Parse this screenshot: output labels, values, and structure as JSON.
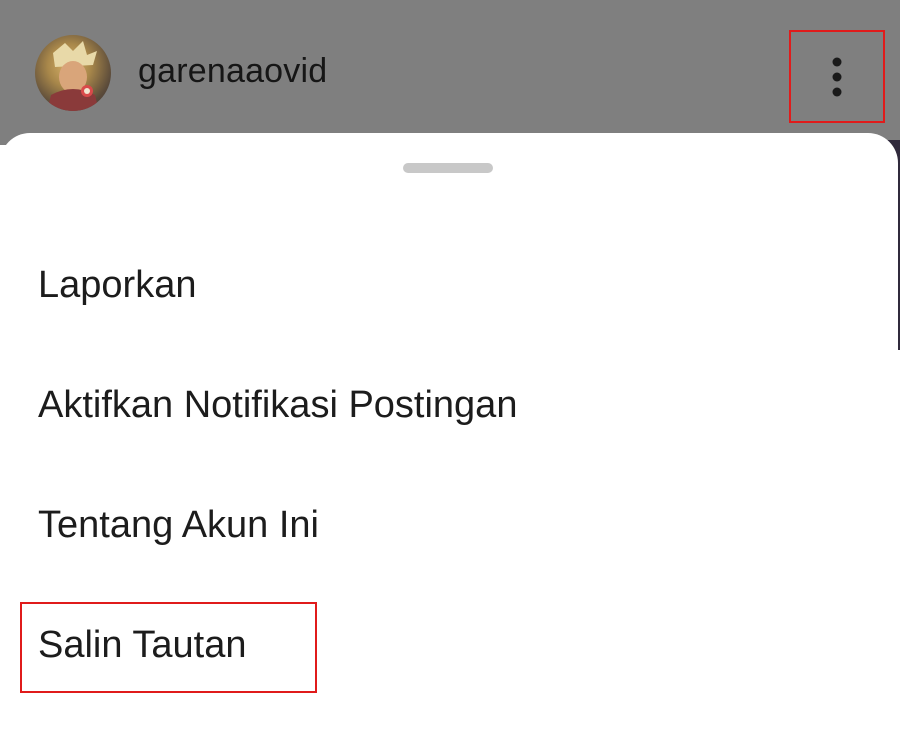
{
  "header": {
    "username": "garenaaovid",
    "avatar_icon": "profile-avatar",
    "more_icon": "vertical-dots-icon",
    "background": "#7f7f7f"
  },
  "sheet": {
    "menu_items": [
      {
        "label": "Laporkan"
      },
      {
        "label": "Aktifkan Notifikasi Postingan"
      },
      {
        "label": "Tentang Akun Ini"
      },
      {
        "label": "Salin Tautan"
      }
    ]
  },
  "annotations": {
    "highlight_color": "#e01b1b"
  }
}
